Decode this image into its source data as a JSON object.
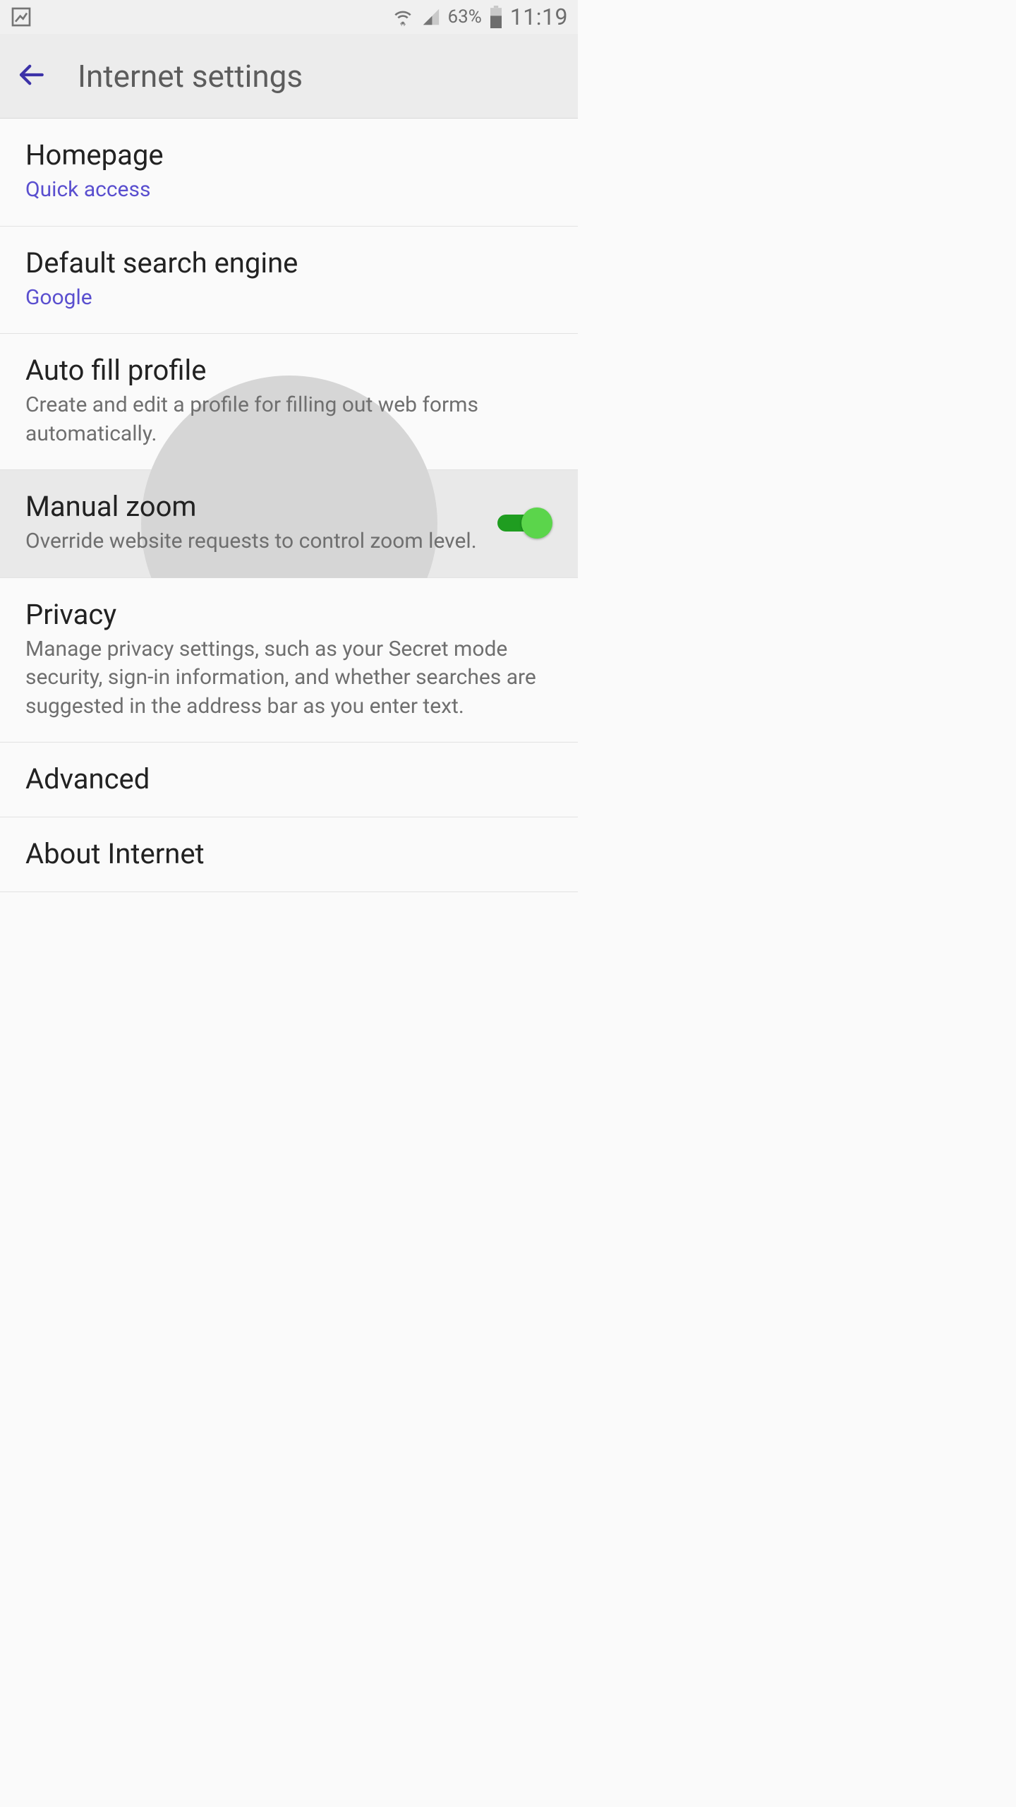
{
  "status_bar": {
    "battery_text": "63%",
    "clock": "11:19"
  },
  "app_bar": {
    "title": "Internet settings"
  },
  "items": {
    "homepage": {
      "title": "Homepage",
      "sub": "Quick access"
    },
    "search_engine": {
      "title": "Default search engine",
      "sub": "Google"
    },
    "autofill": {
      "title": "Auto fill profile",
      "sub": "Create and edit a profile for filling out web forms automatically."
    },
    "manual_zoom": {
      "title": "Manual zoom",
      "sub": "Override website requests to control zoom level.",
      "toggle": true
    },
    "privacy": {
      "title": "Privacy",
      "sub": "Manage privacy settings, such as your Secret mode security, sign-in information, and whether searches are suggested in the address bar as you enter text."
    },
    "advanced": {
      "title": "Advanced"
    },
    "about": {
      "title": "About Internet"
    }
  }
}
